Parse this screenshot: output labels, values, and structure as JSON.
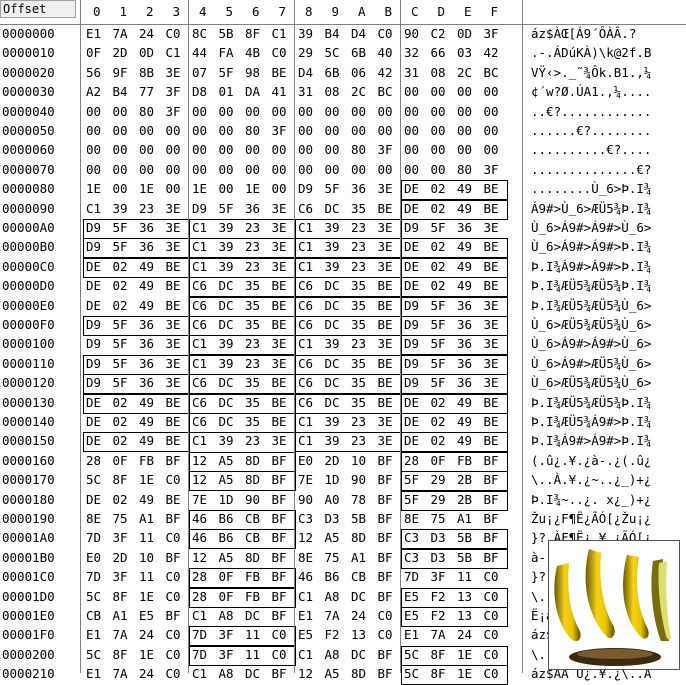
{
  "header": {
    "offset_label": "Offset",
    "columns": [
      "0",
      "1",
      "2",
      "3",
      "4",
      "5",
      "6",
      "7",
      "8",
      "9",
      "A",
      "B",
      "C",
      "D",
      "E",
      "F"
    ]
  },
  "rows": [
    {
      "offset": "0000000",
      "bytes": [
        "E1",
        "7A",
        "24",
        "C0",
        "8C",
        "5B",
        "8F",
        "C1",
        "39",
        "B4",
        "D4",
        "C0",
        "90",
        "C2",
        "0D",
        "3F"
      ],
      "ascii": "áz$ÀŒ[Á9´ÔÀÂ.?"
    },
    {
      "offset": "0000010",
      "bytes": [
        "0F",
        "2D",
        "0D",
        "C1",
        "44",
        "FA",
        "4B",
        "C0",
        "29",
        "5C",
        "6B",
        "40",
        "32",
        "66",
        "03",
        "42"
      ],
      "ascii": ".-.ÁDúKÀ)\\k@2f.B"
    },
    {
      "offset": "0000020",
      "bytes": [
        "56",
        "9F",
        "8B",
        "3E",
        "07",
        "5F",
        "98",
        "BE",
        "D4",
        "6B",
        "06",
        "42",
        "31",
        "08",
        "2C",
        "BC"
      ],
      "ascii": "VŸ‹>._˜¾Ôk.B1.,¼"
    },
    {
      "offset": "0000030",
      "bytes": [
        "A2",
        "B4",
        "77",
        "3F",
        "D8",
        "01",
        "DA",
        "41",
        "31",
        "08",
        "2C",
        "BC",
        "00",
        "00",
        "00",
        "00"
      ],
      "ascii": "¢´w?Ø.ÚA1.,¼...."
    },
    {
      "offset": "0000040",
      "bytes": [
        "00",
        "00",
        "80",
        "3F",
        "00",
        "00",
        "00",
        "00",
        "00",
        "00",
        "00",
        "00",
        "00",
        "00",
        "00",
        "00"
      ],
      "ascii": "..€?............"
    },
    {
      "offset": "0000050",
      "bytes": [
        "00",
        "00",
        "00",
        "00",
        "00",
        "00",
        "80",
        "3F",
        "00",
        "00",
        "00",
        "00",
        "00",
        "00",
        "00",
        "00"
      ],
      "ascii": "......€?........"
    },
    {
      "offset": "0000060",
      "bytes": [
        "00",
        "00",
        "00",
        "00",
        "00",
        "00",
        "00",
        "00",
        "00",
        "00",
        "80",
        "3F",
        "00",
        "00",
        "00",
        "00"
      ],
      "ascii": "..........€?...."
    },
    {
      "offset": "0000070",
      "bytes": [
        "00",
        "00",
        "00",
        "00",
        "00",
        "00",
        "00",
        "00",
        "00",
        "00",
        "00",
        "00",
        "00",
        "00",
        "80",
        "3F"
      ],
      "ascii": "..............€?"
    },
    {
      "offset": "0000080",
      "bytes": [
        "1E",
        "00",
        "1E",
        "00",
        "1E",
        "00",
        "1E",
        "00",
        "D9",
        "5F",
        "36",
        "3E",
        "DE",
        "02",
        "49",
        "BE"
      ],
      "ascii": "........Ù_6>Þ.I¾"
    },
    {
      "offset": "0000090",
      "bytes": [
        "C1",
        "39",
        "23",
        "3E",
        "D9",
        "5F",
        "36",
        "3E",
        "C6",
        "DC",
        "35",
        "BE",
        "DE",
        "02",
        "49",
        "BE"
      ],
      "ascii": "Á9#>Ù_6>ÆÜ5¾Þ.I¾"
    },
    {
      "offset": "00000A0",
      "bytes": [
        "D9",
        "5F",
        "36",
        "3E",
        "C1",
        "39",
        "23",
        "3E",
        "C1",
        "39",
        "23",
        "3E",
        "D9",
        "5F",
        "36",
        "3E"
      ],
      "ascii": "Ù_6>Á9#>Á9#>Ù_6>"
    },
    {
      "offset": "00000B0",
      "bytes": [
        "D9",
        "5F",
        "36",
        "3E",
        "C1",
        "39",
        "23",
        "3E",
        "C1",
        "39",
        "23",
        "3E",
        "DE",
        "02",
        "49",
        "BE"
      ],
      "ascii": "Ù_6>Á9#>Á9#>Þ.I¾"
    },
    {
      "offset": "00000C0",
      "bytes": [
        "DE",
        "02",
        "49",
        "BE",
        "C1",
        "39",
        "23",
        "3E",
        "C1",
        "39",
        "23",
        "3E",
        "DE",
        "02",
        "49",
        "BE"
      ],
      "ascii": "Þ.I¾Á9#>Á9#>Þ.I¾"
    },
    {
      "offset": "00000D0",
      "bytes": [
        "DE",
        "02",
        "49",
        "BE",
        "C6",
        "DC",
        "35",
        "BE",
        "C6",
        "DC",
        "35",
        "BE",
        "DE",
        "02",
        "49",
        "BE"
      ],
      "ascii": "Þ.I¾ÆÜ5¾ÆÜ5¾Þ.I¾"
    },
    {
      "offset": "00000E0",
      "bytes": [
        "DE",
        "02",
        "49",
        "BE",
        "C6",
        "DC",
        "35",
        "BE",
        "C6",
        "DC",
        "35",
        "BE",
        "D9",
        "5F",
        "36",
        "3E"
      ],
      "ascii": "Þ.I¾ÆÜ5¾ÆÜ5¾Ù_6>"
    },
    {
      "offset": "00000F0",
      "bytes": [
        "D9",
        "5F",
        "36",
        "3E",
        "C6",
        "DC",
        "35",
        "BE",
        "C6",
        "DC",
        "35",
        "BE",
        "D9",
        "5F",
        "36",
        "3E"
      ],
      "ascii": "Ù_6>ÆÜ5¾ÆÜ5¾Ù_6>"
    },
    {
      "offset": "0000100",
      "bytes": [
        "D9",
        "5F",
        "36",
        "3E",
        "C1",
        "39",
        "23",
        "3E",
        "C1",
        "39",
        "23",
        "3E",
        "D9",
        "5F",
        "36",
        "3E"
      ],
      "ascii": "Ù_6>Á9#>Á9#>Ù_6>"
    },
    {
      "offset": "0000110",
      "bytes": [
        "D9",
        "5F",
        "36",
        "3E",
        "C1",
        "39",
        "23",
        "3E",
        "C6",
        "DC",
        "35",
        "BE",
        "D9",
        "5F",
        "36",
        "3E"
      ],
      "ascii": "Ù_6>Á9#>ÆÜ5¾Ù_6>"
    },
    {
      "offset": "0000120",
      "bytes": [
        "D9",
        "5F",
        "36",
        "3E",
        "C6",
        "DC",
        "35",
        "BE",
        "C6",
        "DC",
        "35",
        "BE",
        "D9",
        "5F",
        "36",
        "3E"
      ],
      "ascii": "Ù_6>ÆÜ5¾ÆÜ5¾Ù_6>"
    },
    {
      "offset": "0000130",
      "bytes": [
        "DE",
        "02",
        "49",
        "BE",
        "C6",
        "DC",
        "35",
        "BE",
        "C6",
        "DC",
        "35",
        "BE",
        "DE",
        "02",
        "49",
        "BE"
      ],
      "ascii": "Þ.I¾ÆÜ5¾ÆÜ5¾Þ.I¾"
    },
    {
      "offset": "0000140",
      "bytes": [
        "DE",
        "02",
        "49",
        "BE",
        "C6",
        "DC",
        "35",
        "BE",
        "C1",
        "39",
        "23",
        "3E",
        "DE",
        "02",
        "49",
        "BE"
      ],
      "ascii": "Þ.I¾ÆÜ5¾Á9#>Þ.I¾"
    },
    {
      "offset": "0000150",
      "bytes": [
        "DE",
        "02",
        "49",
        "BE",
        "C1",
        "39",
        "23",
        "3E",
        "C1",
        "39",
        "23",
        "3E",
        "DE",
        "02",
        "49",
        "BE"
      ],
      "ascii": "Þ.I¾Á9#>Á9#>Þ.I¾"
    },
    {
      "offset": "0000160",
      "bytes": [
        "28",
        "0F",
        "FB",
        "BF",
        "12",
        "A5",
        "8D",
        "BF",
        "E0",
        "2D",
        "10",
        "BF",
        "28",
        "0F",
        "FB",
        "BF"
      ],
      "ascii": "(.û¿.¥.¿à-.¿(.û¿"
    },
    {
      "offset": "0000170",
      "bytes": [
        "5C",
        "8F",
        "1E",
        "C0",
        "12",
        "A5",
        "8D",
        "BF",
        "7E",
        "1D",
        "90",
        "BF",
        "5F",
        "29",
        "2B",
        "BF"
      ],
      "ascii": "\\..À.¥.¿~..¿_)+¿"
    },
    {
      "offset": "0000180",
      "bytes": [
        "DE",
        "02",
        "49",
        "BE",
        "7E",
        "1D",
        "90",
        "BF",
        "90",
        "A0",
        "78",
        "BF",
        "5F",
        "29",
        "2B",
        "BF"
      ],
      "ascii": "Þ.I¾~..¿. x¿_)+¿"
    },
    {
      "offset": "0000190",
      "bytes": [
        "8E",
        "75",
        "A1",
        "BF",
        "46",
        "B6",
        "CB",
        "BF",
        "C3",
        "D3",
        "5B",
        "BF",
        "8E",
        "75",
        "A1",
        "BF"
      ],
      "ascii": "Žu¡¿F¶Ë¿ÃÓ[¿Žu¡¿"
    },
    {
      "offset": "00001A0",
      "bytes": [
        "7D",
        "3F",
        "11",
        "C0",
        "46",
        "B6",
        "CB",
        "BF",
        "12",
        "A5",
        "8D",
        "BF",
        "C3",
        "D3",
        "5B",
        "BF"
      ],
      "ascii": "}?.ÀF¶Ë¿.¥.¿ÃÓ[¿"
    },
    {
      "offset": "00001B0",
      "bytes": [
        "E0",
        "2D",
        "10",
        "BF",
        "12",
        "A5",
        "8D",
        "BF",
        "8E",
        "75",
        "A1",
        "BF",
        "C3",
        "D3",
        "5B",
        "BF"
      ],
      "ascii": "à-.¿.¥.¿Žu¡¿ÃÓ[¿"
    },
    {
      "offset": "00001C0",
      "bytes": [
        "7D",
        "3F",
        "11",
        "C0",
        "28",
        "0F",
        "FB",
        "BF",
        "46",
        "B6",
        "CB",
        "BF",
        "7D",
        "3F",
        "11",
        "C0"
      ],
      "ascii": "}?.À(.û¿F¶Ë¿}?.À"
    },
    {
      "offset": "00001D0",
      "bytes": [
        "5C",
        "8F",
        "1E",
        "C0",
        "28",
        "0F",
        "FB",
        "BF",
        "C1",
        "A8",
        "DC",
        "BF",
        "E5",
        "F2",
        "13",
        "C0"
      ],
      "ascii": "\\..À(.û¿Á¨Ü¿åò.À"
    },
    {
      "offset": "00001E0",
      "bytes": [
        "CB",
        "A1",
        "E5",
        "BF",
        "C1",
        "A8",
        "DC",
        "BF",
        "E1",
        "7A",
        "24",
        "C0",
        "E5",
        "F2",
        "13",
        "C0"
      ],
      "ascii": "Ë¡å¿Á¨Ü¿áz$Àåò.À"
    },
    {
      "offset": "00001F0",
      "bytes": [
        "E1",
        "7A",
        "24",
        "C0",
        "7D",
        "3F",
        "11",
        "C0",
        "E5",
        "F2",
        "13",
        "C0",
        "E1",
        "7A",
        "24",
        "C0"
      ],
      "ascii": "áz$À}?.Àåò.Àáz$À"
    },
    {
      "offset": "0000200",
      "bytes": [
        "5C",
        "8F",
        "1E",
        "C0",
        "7D",
        "3F",
        "11",
        "C0",
        "C1",
        "A8",
        "DC",
        "BF",
        "5C",
        "8F",
        "1E",
        "C0"
      ],
      "ascii": "\\..À}?.ÀÁ¨Ü¿\\..À"
    },
    {
      "offset": "0000210",
      "bytes": [
        "E1",
        "7A",
        "24",
        "C0",
        "C1",
        "A8",
        "DC",
        "BF",
        "12",
        "A5",
        "8D",
        "BF",
        "5C",
        "8F",
        "1E",
        "C0"
      ],
      "ascii": "áz$ÀÁ¨Ü¿.¥.¿\\..À"
    }
  ],
  "boxes": [
    [
      8,
      3
    ],
    [
      9,
      3
    ],
    [
      10,
      0
    ],
    [
      10,
      1
    ],
    [
      10,
      2
    ],
    [
      11,
      0
    ],
    [
      11,
      1
    ],
    [
      11,
      2
    ],
    [
      11,
      3
    ],
    [
      12,
      0
    ],
    [
      12,
      1
    ],
    [
      12,
      2
    ],
    [
      12,
      3
    ],
    [
      13,
      1
    ],
    [
      13,
      2
    ],
    [
      13,
      3
    ],
    [
      14,
      1
    ],
    [
      14,
      2
    ],
    [
      14,
      3
    ],
    [
      15,
      0
    ],
    [
      15,
      1
    ],
    [
      15,
      2
    ],
    [
      15,
      3
    ],
    [
      16,
      1
    ],
    [
      16,
      3
    ],
    [
      17,
      0
    ],
    [
      17,
      1
    ],
    [
      17,
      2
    ],
    [
      17,
      3
    ],
    [
      18,
      0
    ],
    [
      18,
      1
    ],
    [
      18,
      2
    ],
    [
      18,
      3
    ],
    [
      19,
      0
    ],
    [
      19,
      1
    ],
    [
      19,
      2
    ],
    [
      19,
      3
    ],
    [
      20,
      1
    ],
    [
      20,
      2
    ],
    [
      20,
      3
    ],
    [
      21,
      0
    ],
    [
      21,
      2
    ],
    [
      21,
      3
    ],
    [
      22,
      1
    ],
    [
      22,
      3
    ],
    [
      23,
      1
    ],
    [
      23,
      3
    ],
    [
      24,
      3
    ],
    [
      25,
      1
    ],
    [
      26,
      1
    ],
    [
      26,
      3
    ],
    [
      27,
      3
    ],
    [
      28,
      1
    ],
    [
      29,
      1
    ],
    [
      29,
      3
    ],
    [
      30,
      3
    ],
    [
      31,
      1
    ],
    [
      32,
      1
    ],
    [
      32,
      3
    ],
    [
      33,
      3
    ]
  ],
  "thumbnail": {
    "icon": "bananas-image"
  }
}
